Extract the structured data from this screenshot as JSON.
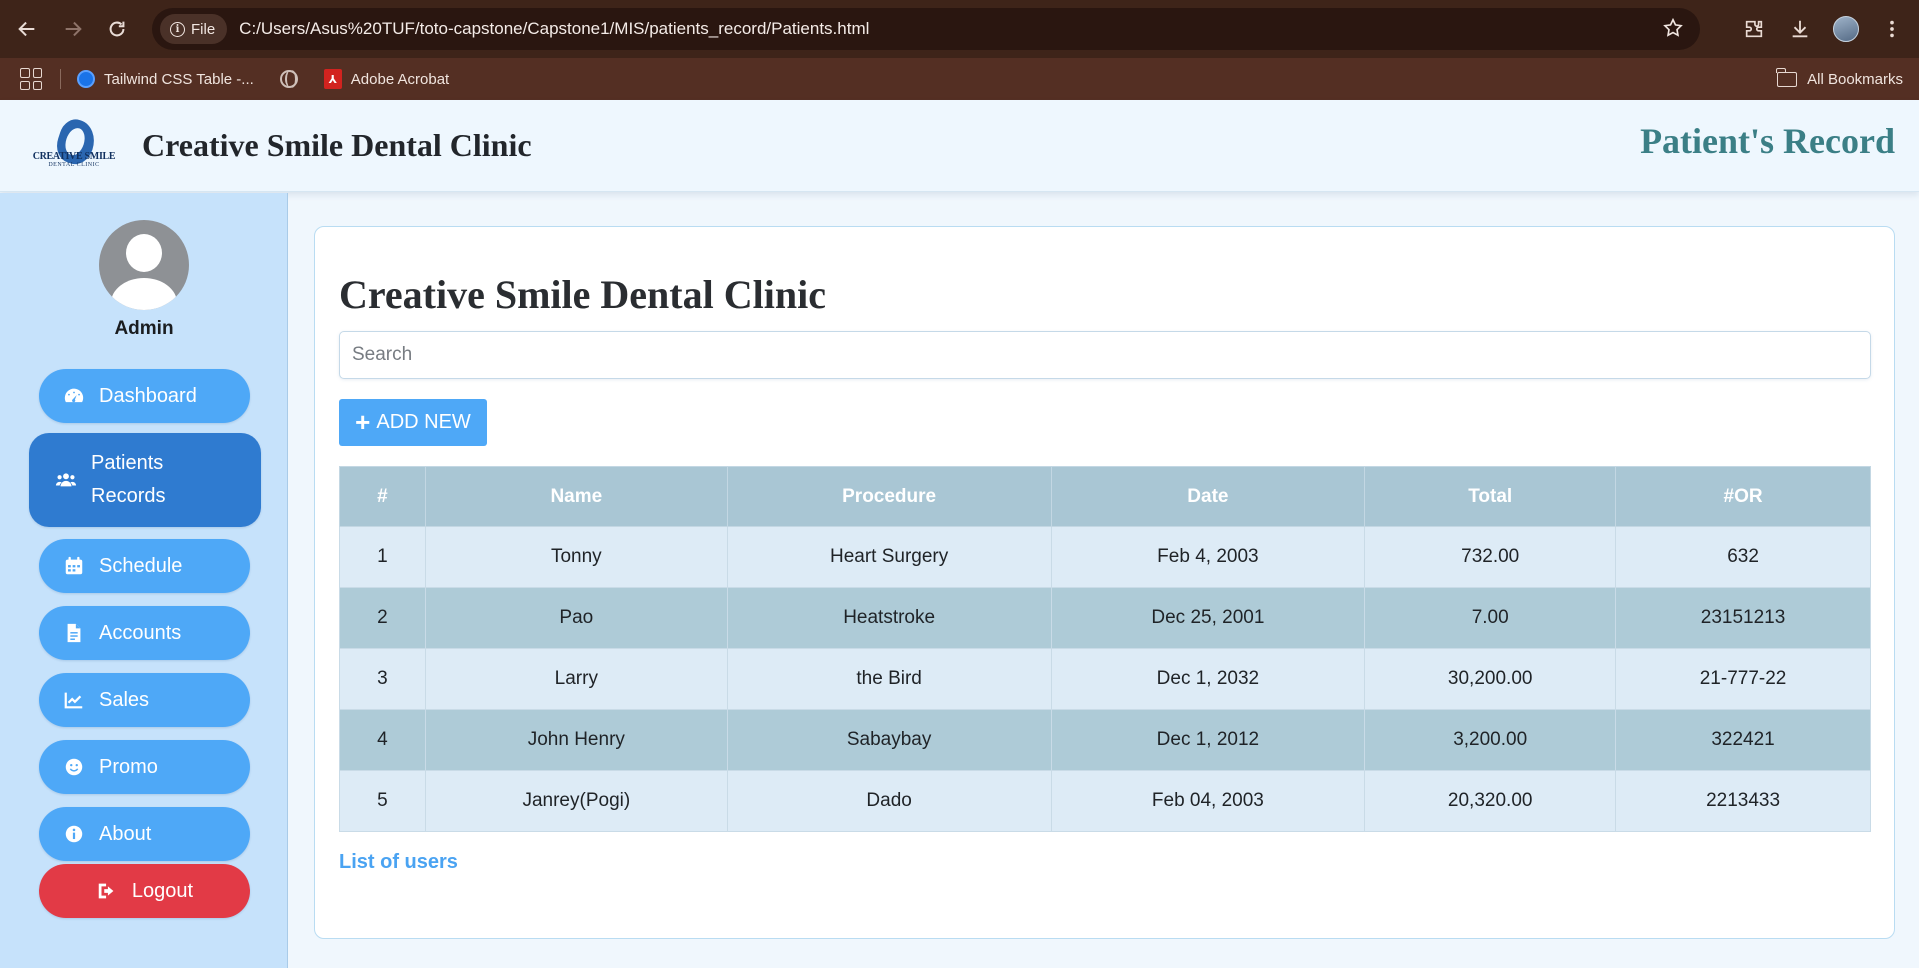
{
  "browser": {
    "file_chip": "File",
    "url": "C:/Users/Asus%20TUF/toto-capstone/Capstone1/MIS/patients_record/Patients.html",
    "bookmarks": [
      {
        "label": "Tailwind CSS Table -..."
      },
      {
        "label": ""
      },
      {
        "label": "Adobe Acrobat"
      }
    ],
    "all_bookmarks": "All Bookmarks"
  },
  "header": {
    "logo_line1": "CREATIVE SMILE",
    "logo_line2": "DENTAL CLINIC",
    "title": "Creative Smile Dental Clinic",
    "page_name": "Patient's Record"
  },
  "sidebar": {
    "user_name": "Admin",
    "items": [
      {
        "label": "Dashboard",
        "icon": "dashboard-icon"
      },
      {
        "label": "Patients Records",
        "icon": "users-icon",
        "active": true
      },
      {
        "label": "Schedule",
        "icon": "calendar-icon"
      },
      {
        "label": "Accounts",
        "icon": "file-icon"
      },
      {
        "label": "Sales",
        "icon": "chart-line-icon"
      },
      {
        "label": "Promo",
        "icon": "smile-icon"
      },
      {
        "label": "About",
        "icon": "info-icon"
      }
    ],
    "logout": "Logout"
  },
  "main": {
    "title": "Creative Smile Dental Clinic",
    "search_placeholder": "Search",
    "search_value": "",
    "add_button": "ADD NEW",
    "table": {
      "headers": [
        "#",
        "Name",
        "Procedure",
        "Date",
        "Total",
        "#OR"
      ],
      "rows": [
        [
          "1",
          "Tonny",
          "Heart Surgery",
          "Feb 4, 2003",
          "732.00",
          "632"
        ],
        [
          "2",
          "Pao",
          "Heatstroke",
          "Dec 25, 2001",
          "7.00",
          "23151213"
        ],
        [
          "3",
          "Larry",
          "the Bird",
          "Dec 1, 2032",
          "30,200.00",
          "21-777-22"
        ],
        [
          "4",
          "John Henry",
          "Sabaybay",
          "Dec 1, 2012",
          "3,200.00",
          "322421"
        ],
        [
          "5",
          "Janrey(Pogi)",
          "Dado",
          "Feb 04, 2003",
          "20,320.00",
          "2213433"
        ]
      ]
    },
    "list_link": "List of users"
  },
  "colors": {
    "browser_bar": "#3e2419",
    "bookmarks_bar": "#542f23",
    "sidebar_bg": "#c6e2fb",
    "button_blue": "#4ea8f7",
    "button_active": "#2f7bd0",
    "logout_red": "#e23a46",
    "table_header": "#a9c6d4",
    "row_light": "#ddebf6",
    "row_dark": "#aecbd7",
    "page_heading_teal": "#3b7f86"
  }
}
